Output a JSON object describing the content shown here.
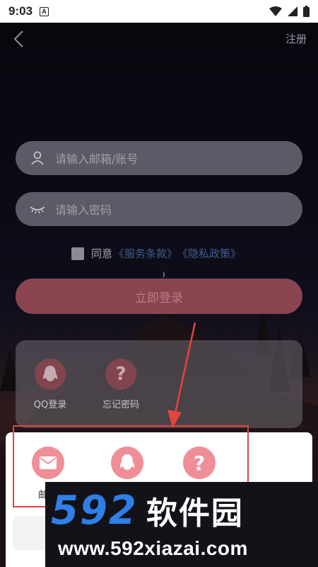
{
  "status_bar": {
    "time": "9:03",
    "a_icon": "A"
  },
  "topbar": {
    "register": "注册"
  },
  "form": {
    "email_placeholder": "请输入邮箱/账号",
    "password_placeholder": "请输入密码",
    "agree_text": "同意",
    "terms_link": "《服务条款》",
    "privacy_link": "《隐私政策》",
    "login_button": "立即登录"
  },
  "other_logins": [
    {
      "label": "QQ登录",
      "icon": "qq-icon"
    },
    {
      "label": "忘记密码",
      "icon": "question-icon"
    }
  ],
  "sheet": {
    "items": [
      {
        "label": "邮箱",
        "icon": "mail-icon"
      },
      {
        "label": "",
        "icon": "qq-icon"
      },
      {
        "label": "",
        "icon": "question-icon"
      }
    ]
  },
  "watermark": {
    "brand_number": "592",
    "brand_name": "软件园",
    "url": "www.592xiazai.com"
  },
  "colors": {
    "accent_pink": "#f08e97",
    "annotation_red": "#e5433f",
    "watermark_blue": "#2f7fe8"
  }
}
